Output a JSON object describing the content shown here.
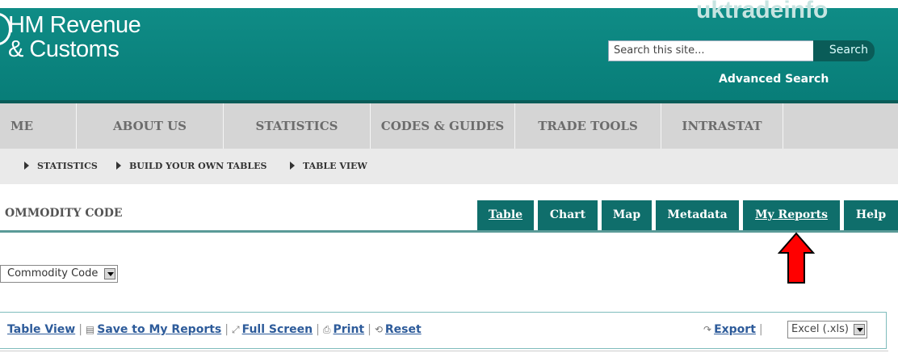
{
  "header": {
    "org_line1": "HM Revenue",
    "org_line2": "& Customs",
    "brand": "uktradeinfo",
    "search_placeholder": "Search this site...",
    "search_button": "Search",
    "advanced_search": "Advanced Search"
  },
  "nav": {
    "items": [
      "ME",
      "ABOUT US",
      "STATISTICS",
      "CODES & GUIDES",
      "TRADE TOOLS",
      "INTRASTAT"
    ]
  },
  "breadcrumb": {
    "items": [
      "STATISTICS",
      "BUILD YOUR OWN TABLES",
      "TABLE VIEW"
    ]
  },
  "page": {
    "title": "OMMODITY CODE",
    "tabs": [
      "Table",
      "Chart",
      "Map",
      "Metadata",
      "My Reports",
      "Help"
    ]
  },
  "filter": {
    "selected": "Commodity Code"
  },
  "toolbar": {
    "table_view": "Table View",
    "save_reports": "Save to My Reports",
    "full_screen": "Full Screen",
    "print": "Print",
    "reset": "Reset",
    "export": "Export",
    "export_format": "Excel (.xls)"
  },
  "colors": {
    "header_teal": "#0f8c86",
    "tab_teal": "#0f6e6b",
    "arrow_red": "#ff0000"
  }
}
